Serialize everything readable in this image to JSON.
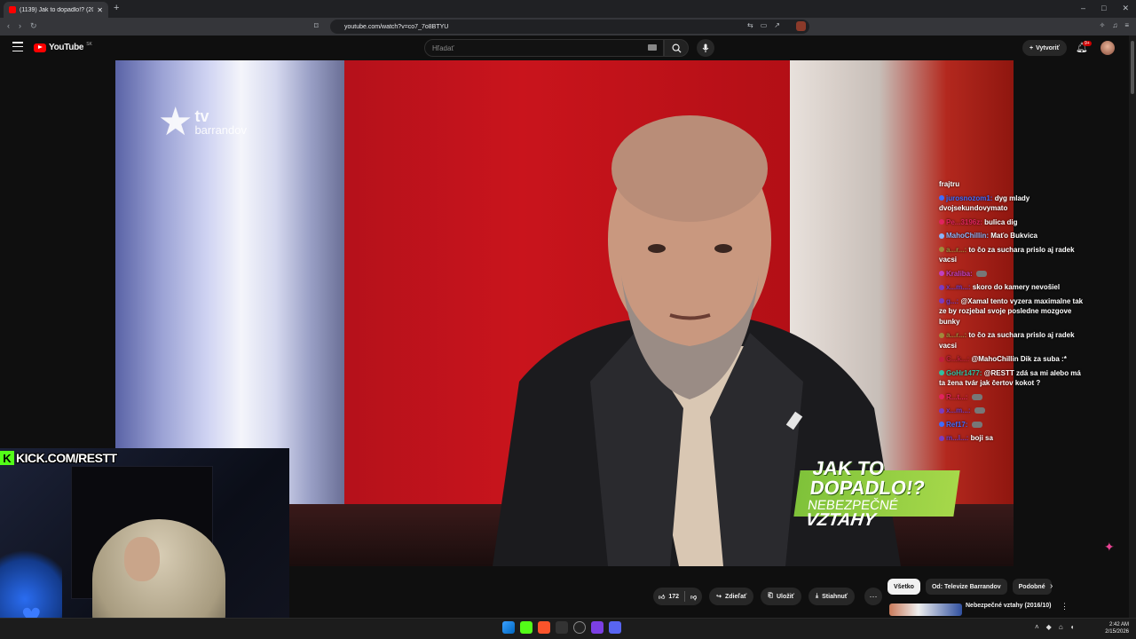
{
  "browser": {
    "tab_title": "(1139) Jak to dopadlo!? (2016",
    "url": "youtube.com/watch?v=co7_7o8BTYU",
    "new_tab": "+",
    "window_controls": [
      "–",
      "□",
      "✕"
    ]
  },
  "youtube": {
    "logo_text": "YouTube",
    "region_code": "SK",
    "search_placeholder": "Hľadať",
    "create_label": "Vytvoriť",
    "notification_count": "9+"
  },
  "video": {
    "channel_watermark_line1": "tv",
    "channel_watermark_line2": "barrandov",
    "show_logo_line1": "JAK TO DOPADLO!?",
    "show_logo_line2a": "NEBEZPEČNÉ",
    "show_logo_line2b": "VZTAHY"
  },
  "stream_overlay": {
    "kick_banner": "KICK.COM/RESTT",
    "chat": [
      {
        "user": "",
        "text": "frajtru",
        "color": "#ffffff"
      },
      {
        "user": "jurosnozom1:",
        "text": "dyg mlady dvojsekundovymato",
        "color": "#3d6cff"
      },
      {
        "user": "Pe...3196z:",
        "text": "bulica dig",
        "color": "#e0245e"
      },
      {
        "user": "MahoChillin:",
        "text": "Maťo Bukvica",
        "color": "#8ab4f8"
      },
      {
        "user": "a...r...:",
        "text": "to čo za suchara prislo aj radek vacsi",
        "color": "#a08a3c"
      },
      {
        "user": "Kraliba:",
        "text": "",
        "color": "#c040c0"
      },
      {
        "user": "x...m...:",
        "text": "skoro do kamery nevošiel",
        "color": "#7a3cc0"
      },
      {
        "user": "g...:",
        "text": "@Xamal tento vyzera maximalne tak ze by rozjebal svoje posledne mozgove bunky",
        "color": "#7a3cc0"
      },
      {
        "user": "a...r...:",
        "text": "to čo za suchara prislo aj radek vacsi",
        "color": "#a08a3c"
      },
      {
        "user": "C...k...:",
        "text": "@MahoChillin Dik za suba :*",
        "color": "#c0203c"
      },
      {
        "user": "GoHr1477:",
        "text": "@RESTT zdá sa mi alebo má ta žena tvár jak čertov kokot ?",
        "color": "#30c0a0"
      },
      {
        "user": "R...t...:",
        "text": "",
        "color": "#e0245e"
      },
      {
        "user": "x...m...:",
        "text": "",
        "color": "#7a3cc0"
      },
      {
        "user": "Ref17:",
        "text": "",
        "color": "#3d6cff"
      },
      {
        "user": "m...l...:",
        "text": "boji sa",
        "color": "#7a3cc0"
      }
    ]
  },
  "actions": {
    "like_count": "172",
    "share_label": "Zdieľať",
    "save_label": "Uložiť",
    "download_label": "Stiahnuť",
    "more": "⋯"
  },
  "chips": [
    "Všetko",
    "Od: Televize Barrandov",
    "Podobné"
  ],
  "related": {
    "title": "Nebezpečné vztahy (2016/10)"
  },
  "taskbar": {
    "time": "2:42 AM",
    "date": "2/15/2026"
  },
  "colors": {
    "youtube_red": "#ff0000",
    "kick_green": "#53fc18",
    "show_green": "#8ccc3f"
  }
}
